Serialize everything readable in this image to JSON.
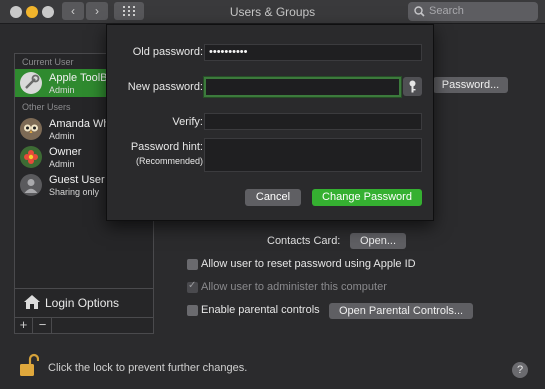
{
  "window": {
    "title": "Users & Groups",
    "back_glyph": "‹",
    "forward_glyph": "›",
    "search_placeholder": "Search"
  },
  "sidebar": {
    "current_user_header": "Current User",
    "current_user": {
      "name": "Apple ToolB",
      "role": "Admin",
      "icon": "wrench-avatar"
    },
    "other_users_header": "Other Users",
    "other_users": [
      {
        "name": "Amanda Wh",
        "role": "Admin",
        "icon": "owl-avatar"
      },
      {
        "name": "Owner",
        "role": "Admin",
        "icon": "flower-avatar"
      },
      {
        "name": "Guest User",
        "role": "Sharing only",
        "icon": "person-silhouette-avatar"
      }
    ],
    "login_options_label": "Login Options",
    "add_glyph": "+",
    "remove_glyph": "−"
  },
  "main": {
    "change_password_partial_label": "Password...",
    "contacts_card_label": "Contacts Card:",
    "open_button_label": "Open...",
    "checkboxes": [
      {
        "label": "Allow user to reset password using Apple ID",
        "checked": false,
        "enabled": true
      },
      {
        "label": "Allow user to administer this computer",
        "checked": true,
        "enabled": false
      },
      {
        "label": "Enable parental controls",
        "checked": false,
        "enabled": true
      }
    ],
    "open_parental_controls_label": "Open Parental Controls..."
  },
  "footer": {
    "lock_text": "Click the lock to prevent further changes.",
    "help_glyph": "?"
  },
  "sheet": {
    "old_password_label": "Old password:",
    "old_password_value": "••••••••••",
    "new_password_label": "New password:",
    "new_password_value": "",
    "verify_label": "Verify:",
    "verify_value": "",
    "hint_label": "Password hint:",
    "hint_sublabel": "(Recommended)",
    "hint_value": "",
    "cancel_label": "Cancel",
    "change_password_label": "Change Password",
    "primary_color": "#35b031",
    "secondary_color": "#5f5f63"
  }
}
